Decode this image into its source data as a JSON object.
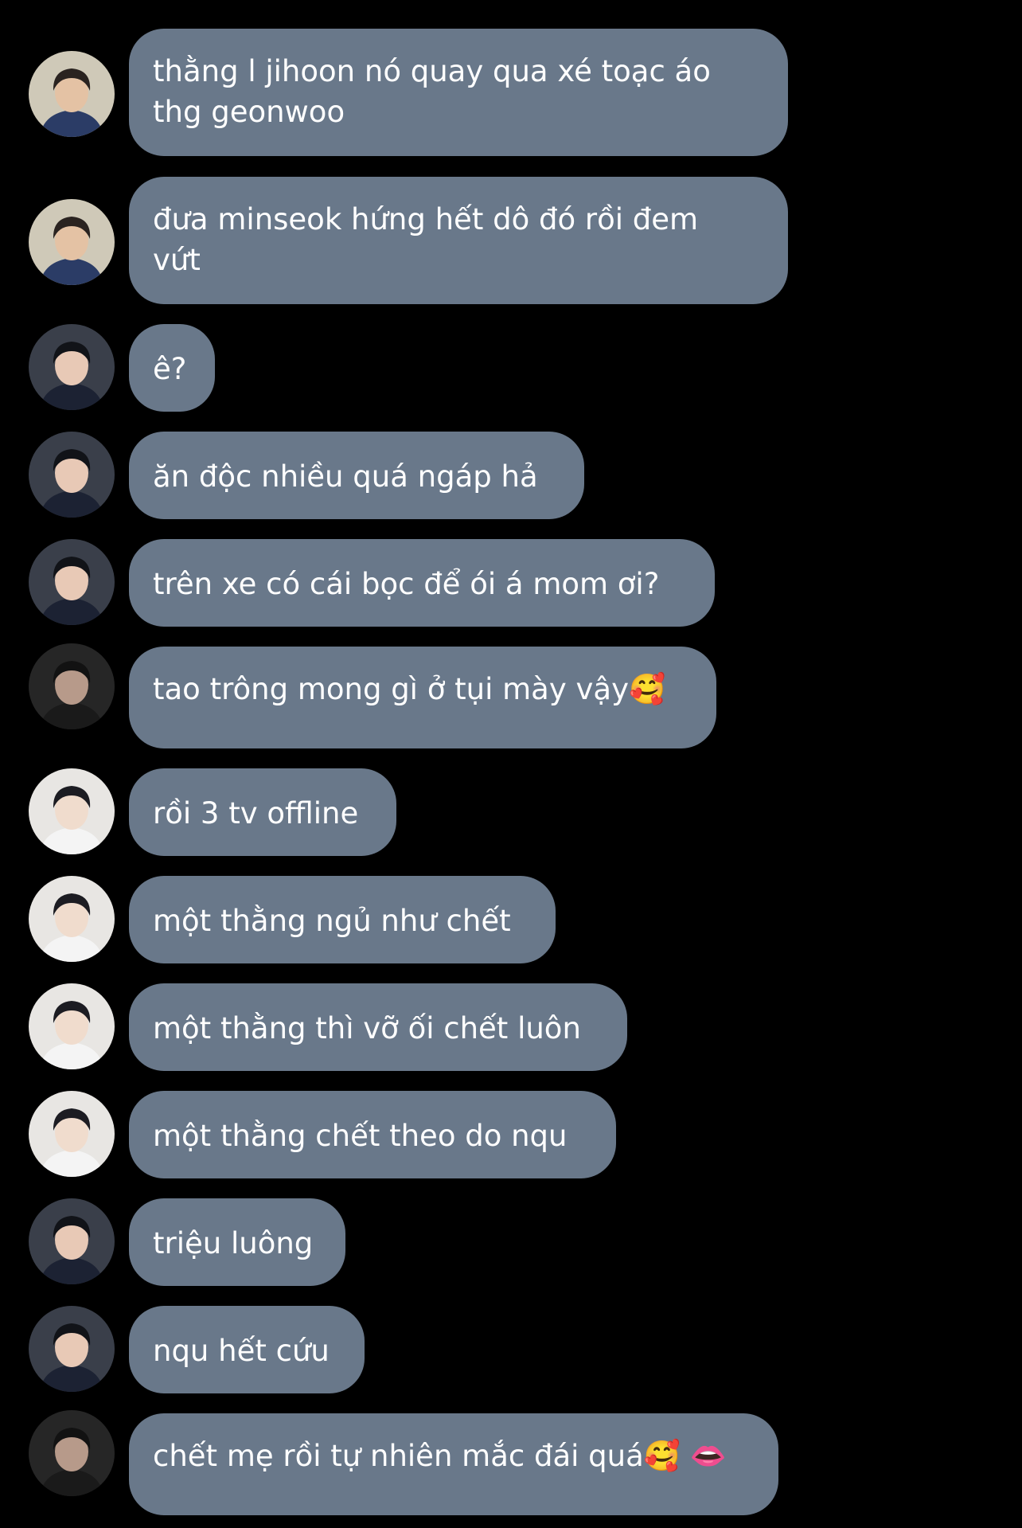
{
  "conversation": {
    "messages": [
      {
        "sender": "user-a",
        "text": "thằng l jihoon nó quay qua xé toạc áo\nthg geonwoo"
      },
      {
        "sender": "user-a",
        "text": "đưa minseok hứng hết dô đó rồi đem\nvứt"
      },
      {
        "sender": "user-b",
        "text": "ê?"
      },
      {
        "sender": "user-b",
        "text": "ăn độc nhiều quá ngáp hả"
      },
      {
        "sender": "user-b",
        "text": "trên xe có cái bọc để ói á mom ơi?"
      },
      {
        "sender": "user-c",
        "text": "tao trông mong gì ở tụi mày vậy🥰"
      },
      {
        "sender": "user-d",
        "text": "rồi 3 tv offline"
      },
      {
        "sender": "user-d",
        "text": "một thằng ngủ như chết"
      },
      {
        "sender": "user-d",
        "text": "một thằng thì vỡ ối chết luôn"
      },
      {
        "sender": "user-d",
        "text": "một thằng chết theo do nqu"
      },
      {
        "sender": "user-b",
        "text": "triệu luông"
      },
      {
        "sender": "user-b",
        "text": "nqu hết cứu"
      },
      {
        "sender": "user-c",
        "text": "chết mẹ rồi tự nhiên mắc đái quá🥰 👄"
      }
    ]
  },
  "theme": {
    "background": "#000000",
    "bubble_color": "#69788a",
    "text_color": "#ffffff"
  },
  "avatars": {
    "user-a": {
      "icon": "avatar-photo-user-a",
      "bg": "#cfc9b8",
      "hair": "#2a2320",
      "skin": "#e4c2a4",
      "cloth": "#2b3c66"
    },
    "user-b": {
      "icon": "avatar-photo-user-b",
      "bg": "#3a3f4a",
      "hair": "#111318",
      "skin": "#e8c9b6",
      "cloth": "#1c2233"
    },
    "user-c": {
      "icon": "avatar-photo-user-c",
      "bg": "#262626",
      "hair": "#121212",
      "skin": "#b79a8a",
      "cloth": "#1a1a1a"
    },
    "user-d": {
      "icon": "avatar-photo-user-d",
      "bg": "#e8e6e3",
      "hair": "#1c1c22",
      "skin": "#f0dccd",
      "cloth": "#f4f4f4"
    }
  }
}
